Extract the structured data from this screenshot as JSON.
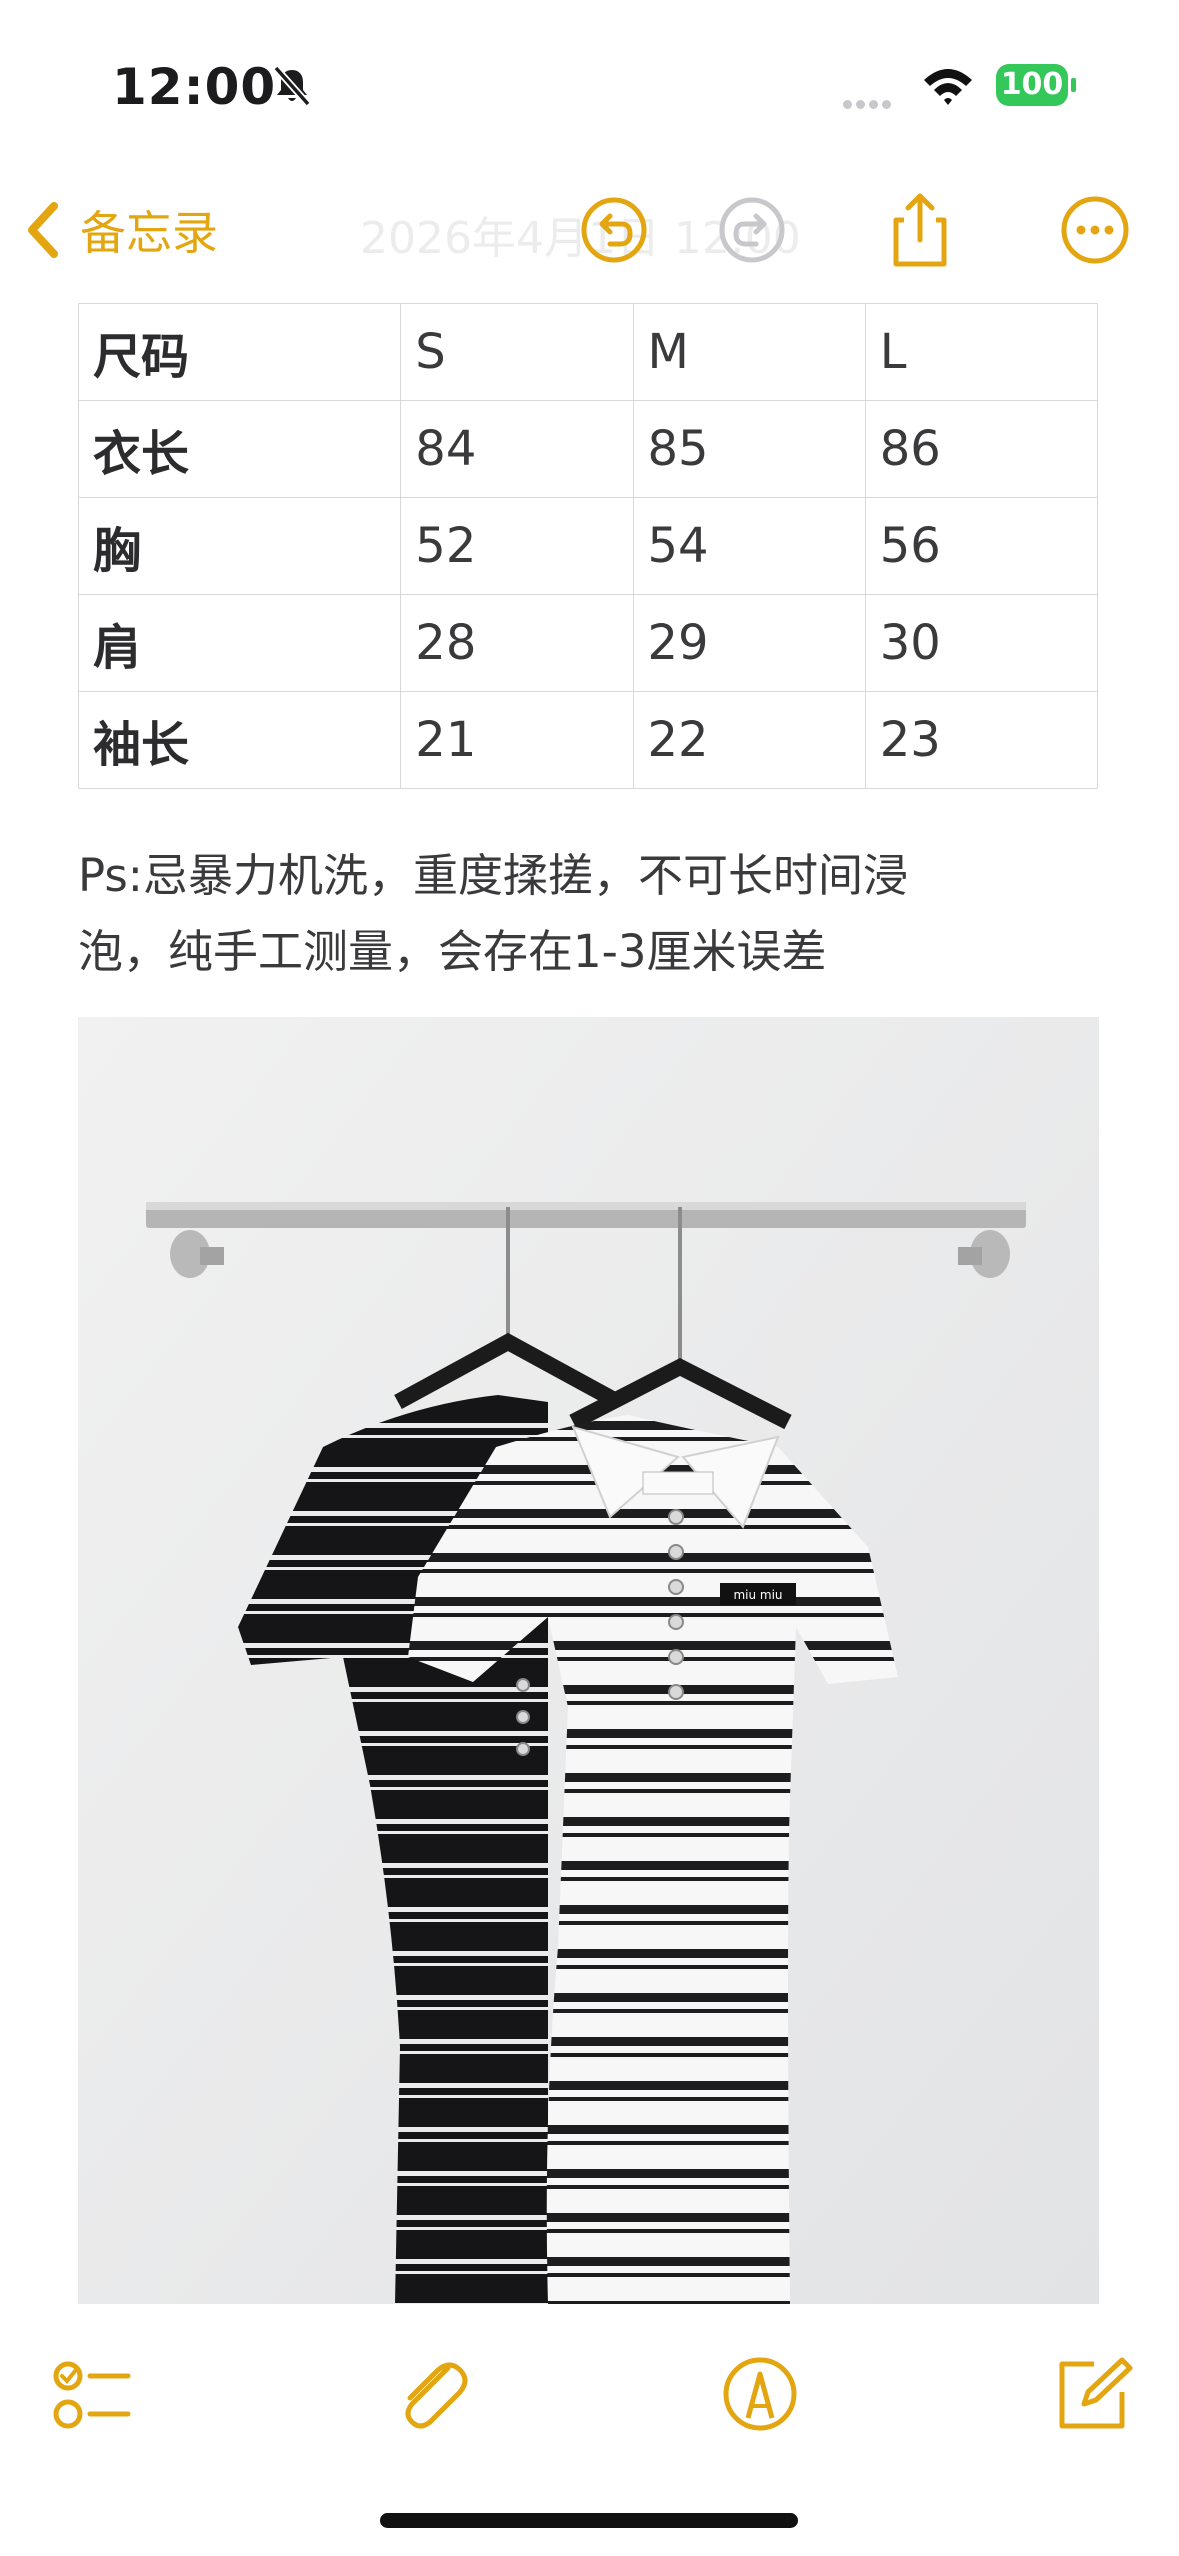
{
  "status_bar": {
    "time": "12:00",
    "battery": "100",
    "icons": [
      "bell-slash-icon",
      "signal-icon",
      "wifi-icon",
      "battery-icon"
    ]
  },
  "nav": {
    "back_label": "备忘录",
    "date_text": "2026年4月1日 12:00",
    "icons": [
      "chevron-left-icon",
      "undo-icon",
      "redo-icon",
      "share-icon",
      "more-icon"
    ],
    "accent": "#E3A510"
  },
  "size_table": {
    "headers": [
      "尺码",
      "S",
      "M",
      "L"
    ],
    "rows": [
      [
        "衣长",
        "84",
        "85",
        "86"
      ],
      [
        "胸",
        "52",
        "54",
        "56"
      ],
      [
        "肩",
        "28",
        "29",
        "30"
      ],
      [
        "袖长",
        "21",
        "22",
        "23"
      ]
    ]
  },
  "note": {
    "line1": "Ps:忌暴力机洗，重度揉搓，不可长时间浸",
    "line2": "泡，纯手工测量，会存在1-3厘米误差"
  },
  "photo": {
    "label_text": "miu miu"
  },
  "toolbar": {
    "icons": [
      "checklist-icon",
      "attachment-icon",
      "markup-icon",
      "compose-icon"
    ]
  }
}
